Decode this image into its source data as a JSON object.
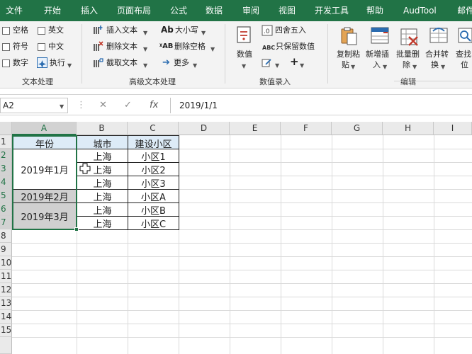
{
  "menu": [
    "文件",
    "开始",
    "插入",
    "页面布局",
    "公式",
    "数据",
    "审阅",
    "视图",
    "开发工具",
    "帮助",
    "AudTool",
    "邮件"
  ],
  "ribbon": {
    "text_process": {
      "checks": [
        "空格",
        "英文",
        "符号",
        "中文",
        "数字"
      ],
      "execute": "执行",
      "group_label": "文本处理"
    },
    "advanced_text": {
      "insert_text": "插入文本",
      "delete_text": "删除文本",
      "extract_text": "截取文本",
      "case": "大小写",
      "delete_space": "删除空格",
      "more": "更多",
      "group_label": "高级文本处理"
    },
    "number_entry": {
      "numeric": "数值",
      "round": "四舍五入",
      "keep_numbers": "只保留数值",
      "group_label": "数值录入"
    },
    "edit": {
      "copy_paste_1": "复制粘",
      "copy_paste_2": "贴",
      "new_insert_1": "新增插",
      "new_insert_2": "入",
      "batch_delete_1": "批量删",
      "batch_delete_2": "除",
      "merge_1": "合并转",
      "merge_2": "换",
      "find_1": "查找",
      "find_2": "位",
      "group_label": "编辑"
    }
  },
  "formula_bar": {
    "name_box": "A2",
    "fx": "fx",
    "value": "2019/1/1"
  },
  "sheet": {
    "columns": [
      "A",
      "B",
      "C",
      "D",
      "E",
      "F",
      "G",
      "H",
      "I"
    ],
    "rows": [
      "1",
      "2",
      "3",
      "4",
      "5",
      "6",
      "7",
      "8",
      "9",
      "10",
      "11",
      "12",
      "13",
      "14",
      "15"
    ],
    "headers": [
      "年份",
      "城市",
      "建设小区"
    ],
    "a_merged": [
      "2019年1月",
      "2019年2月",
      "2019年3月"
    ],
    "cities": [
      "上海",
      "上海",
      "上海",
      "上海",
      "上海",
      "上海"
    ],
    "districts": [
      "小区1",
      "小区2",
      "小区3",
      "小区A",
      "小区B",
      "小区C"
    ]
  }
}
